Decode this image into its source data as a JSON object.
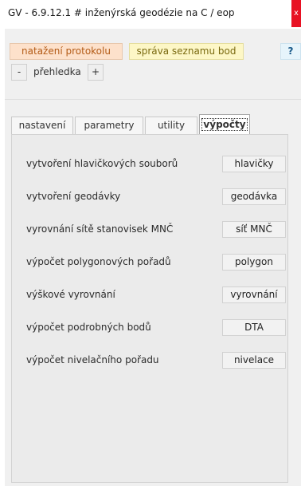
{
  "window": {
    "title": "GV - 6.9.12.1 # inženýrská geodézie na C / eop",
    "close_symbol": "x"
  },
  "toolbar": {
    "protocol_label": "natažení protokolu",
    "points_label": "správa  seznamu bod",
    "help_label": "?",
    "minus_label": "-",
    "overview_label": "přehledka",
    "plus_label": "+"
  },
  "tabs": [
    {
      "label": "nastavení",
      "active": false
    },
    {
      "label": "parametry",
      "active": false
    },
    {
      "label": "utility",
      "active": false
    },
    {
      "label": "výpočty",
      "active": true
    }
  ],
  "rows": [
    {
      "label": "vytvoření hlavičkových souborů",
      "button": "hlavičky"
    },
    {
      "label": "vytvoření geodávky",
      "button": "geodávka"
    },
    {
      "label": "vyrovnání sítě stanovisek MNČ",
      "button": "síť MNČ"
    },
    {
      "label": "výpočet polygonových pořadů",
      "button": "polygon"
    },
    {
      "label": "výškové vyrovnání",
      "button": "vyrovnání"
    },
    {
      "label": "výpočet podrobných bodů",
      "button": "DTA"
    },
    {
      "label": "výpočet nivelačního pořadu",
      "button": "nivelace"
    }
  ],
  "colors": {
    "protocol_bg": "#fde1cb",
    "points_bg": "#fdf7c6",
    "help_bg": "#e6f4fb",
    "close_bg": "#e81123"
  }
}
